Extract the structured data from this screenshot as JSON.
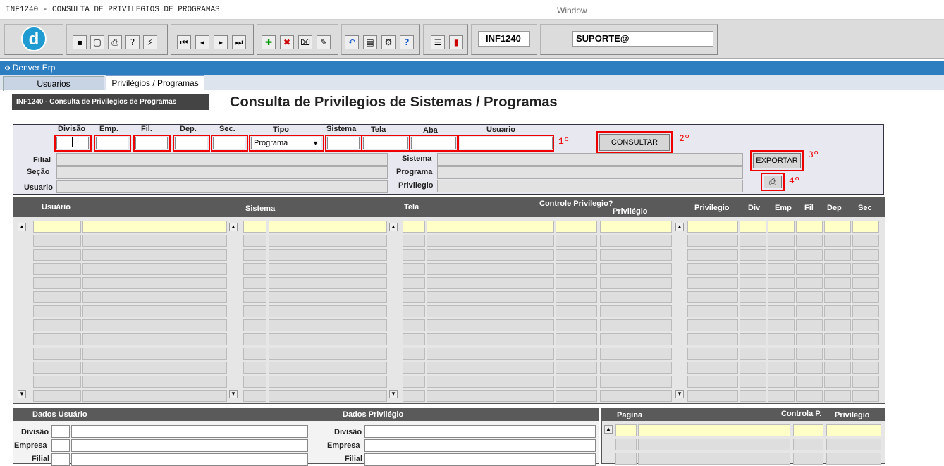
{
  "window": {
    "title": "INF1240 - CONSULTA DE PRIVILEGIOS DE PROGRAMAS",
    "center_label": "Window"
  },
  "toolbar": {
    "form_code": "INF1240",
    "user": "SUPORTE@",
    "logo_letter": "d"
  },
  "app": {
    "name": "Denver Erp"
  },
  "tabs": [
    {
      "label": "Usuarios"
    },
    {
      "label": "Privilégios / Programas"
    }
  ],
  "form": {
    "code_title": "INF1240 - Consulta de Privilegios de Programas",
    "title": "Consulta de Privilegios de Sistemas / Programas"
  },
  "filters": {
    "labels": {
      "divisao": "Divisão",
      "emp": "Emp.",
      "fil": "Fil.",
      "dep": "Dep.",
      "sec": "Sec.",
      "tipo": "Tipo",
      "sistema": "Sistema",
      "tela": "Tela",
      "aba": "Aba",
      "usuario": "Usuario"
    },
    "tipo_value": "Programa",
    "left_labels": {
      "filial": "Filial",
      "secao": "Seção",
      "usuario": "Usuario"
    },
    "right_labels": {
      "sistema": "Sistema",
      "programa": "Programa",
      "privilegio": "Privilegio"
    }
  },
  "buttons": {
    "consultar": "CONSULTAR",
    "exportar": "EXPORTAR"
  },
  "steps": [
    "1º",
    "2º",
    "3º",
    "4º"
  ],
  "grid": {
    "headers": {
      "usuario": "Usuário",
      "sistema": "Sistema",
      "tela": "Tela",
      "controle": "Controle Privilegio?",
      "privilegio": "Privilégio",
      "privilegio2": "Privilegio",
      "div": "Div",
      "emp": "Emp",
      "fil": "Fil",
      "dep": "Dep",
      "sec": "Sec"
    }
  },
  "dados": {
    "usuario_title": "Dados Usuário",
    "privilegio_title": "Dados Privilégio",
    "labels": [
      "Divisão",
      "Empresa",
      "Filial"
    ]
  },
  "paginas": {
    "pagina": "Pagina",
    "controla": "Controla P.",
    "privilegio": "Privilegio"
  },
  "colors": {
    "accent": "#2d7ec0",
    "highlight": "#e00000",
    "required_field": "#ffffc8"
  }
}
